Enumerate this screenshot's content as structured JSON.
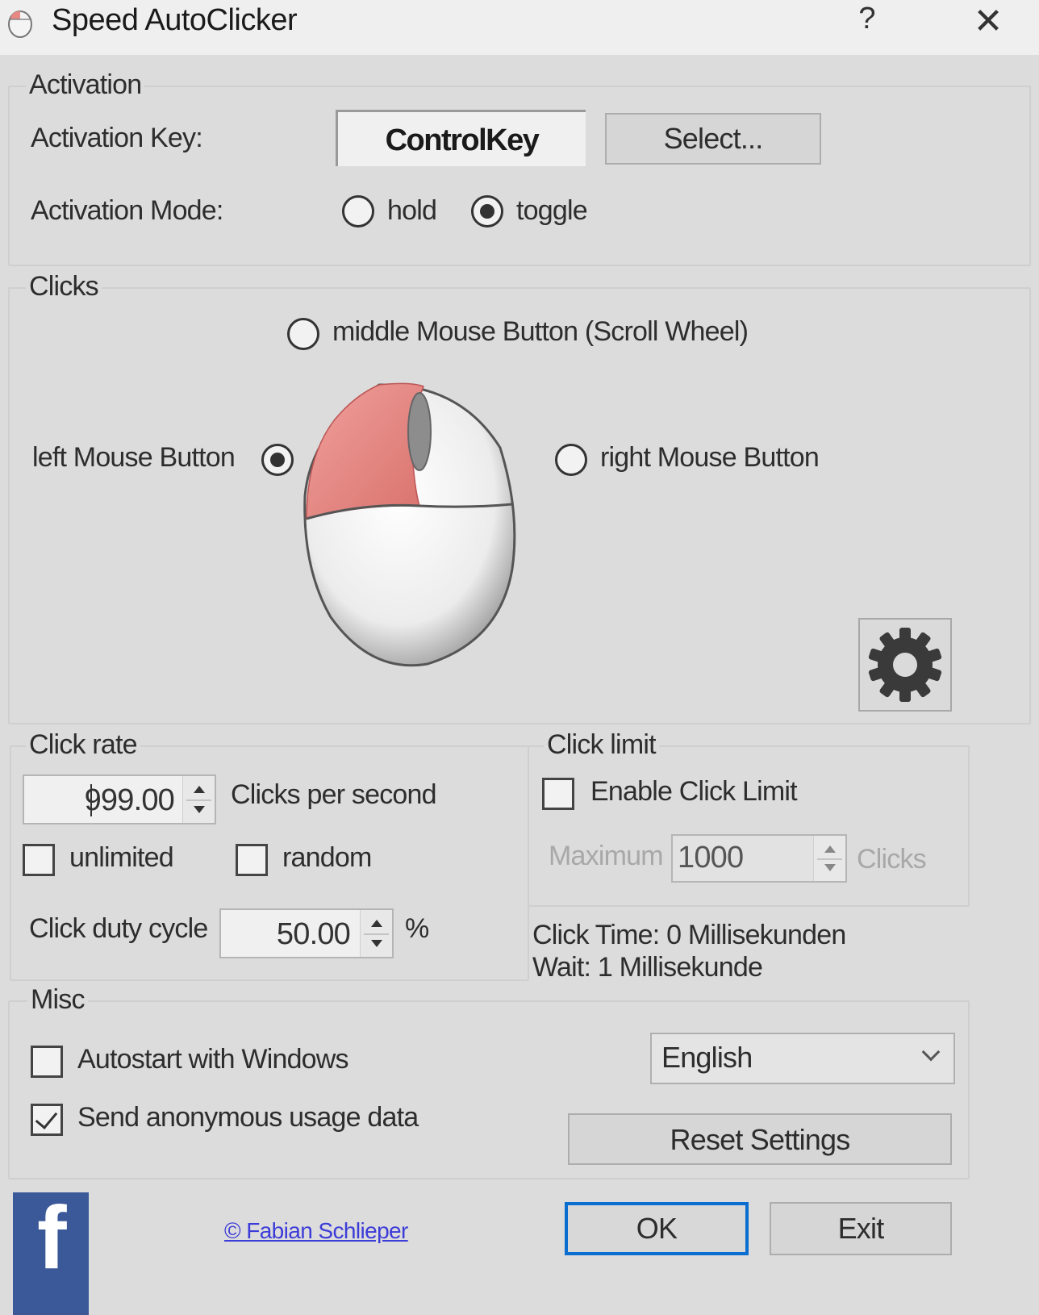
{
  "window": {
    "title": "Speed AutoClicker",
    "help_label": "?",
    "close_label": "✕"
  },
  "activation": {
    "group_label": "Activation",
    "key_label": "Activation Key:",
    "key_value": "ControlKey",
    "select_button": "Select...",
    "mode_label": "Activation Mode:",
    "modes": [
      {
        "label": "hold",
        "checked": false
      },
      {
        "label": "toggle",
        "checked": true
      }
    ]
  },
  "clicks": {
    "group_label": "Clicks",
    "middle_label": "middle Mouse Button (Scroll Wheel)",
    "left_label": "left Mouse Button",
    "right_label": "right Mouse Button",
    "selected": "left",
    "highlight_color": "#e88884",
    "settings_icon": "gear-icon"
  },
  "click_rate": {
    "group_label": "Click rate",
    "value": "999.00",
    "unit_label": "Clicks per second",
    "unlimited_label": "unlimited",
    "unlimited_checked": false,
    "random_label": "random",
    "random_checked": false,
    "duty_label": "Click duty cycle",
    "duty_value": "50.00",
    "duty_unit": "%"
  },
  "click_limit": {
    "group_label": "Click limit",
    "enable_label": "Enable Click Limit",
    "enable_checked": false,
    "max_label": "Maximum",
    "max_value": "1000",
    "max_unit": "Clicks"
  },
  "timing": {
    "click_time": "Click Time: 0 Millisekunden",
    "wait": "Wait: 1 Millisekunde"
  },
  "misc": {
    "group_label": "Misc",
    "autostart_label": "Autostart with Windows",
    "autostart_checked": false,
    "usage_label": "Send anonymous usage data",
    "usage_checked": true,
    "language": "English",
    "reset_button": "Reset Settings"
  },
  "footer": {
    "facebook_icon": "facebook-icon",
    "facebook_color": "#3b5998",
    "credit": "© Fabian Schlieper",
    "ok_button": "OK",
    "exit_button": "Exit"
  }
}
